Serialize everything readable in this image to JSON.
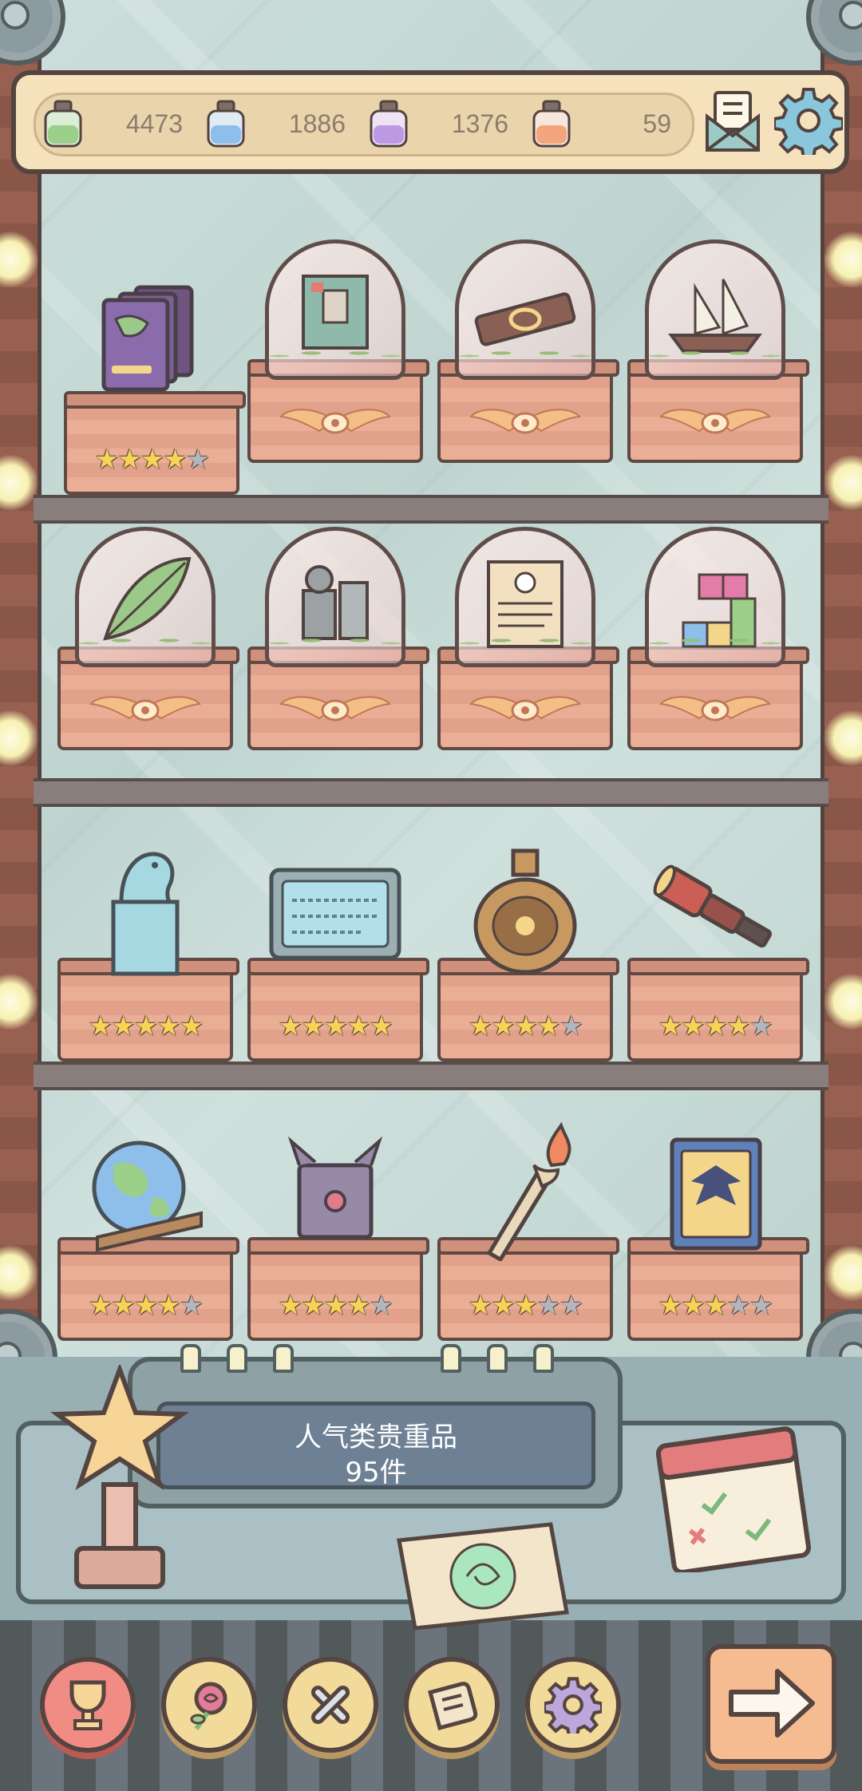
{
  "resources": [
    {
      "icon": "green-ink-bottle-icon",
      "value": "4473",
      "color": "#8fc97a"
    },
    {
      "icon": "blue-ink-bottle-icon",
      "value": "1886",
      "color": "#7fb7e8"
    },
    {
      "icon": "purple-ink-bottle-icon",
      "value": "1376",
      "color": "#b58be0"
    },
    {
      "icon": "orange-ink-bottle-icon",
      "value": "59",
      "color": "#f29a6a"
    }
  ],
  "shelves": [
    {
      "items": [
        {
          "name": "book-stack",
          "state": "owned",
          "stars": 4,
          "max_stars": 5
        },
        {
          "name": "locked-scroll-1",
          "state": "domed"
        },
        {
          "name": "locked-scroll-2",
          "state": "domed"
        },
        {
          "name": "locked-ship",
          "state": "domed"
        }
      ]
    },
    {
      "items": [
        {
          "name": "locked-feather",
          "state": "domed"
        },
        {
          "name": "locked-statue",
          "state": "domed"
        },
        {
          "name": "locked-document",
          "state": "domed"
        },
        {
          "name": "locked-blocks",
          "state": "domed"
        }
      ]
    },
    {
      "items": [
        {
          "name": "dragon-statue",
          "state": "owned",
          "stars": 5,
          "max_stars": 5
        },
        {
          "name": "stone-tablet",
          "state": "owned",
          "stars": 5,
          "max_stars": 5
        },
        {
          "name": "ornate-flask",
          "state": "owned",
          "stars": 4,
          "max_stars": 5
        },
        {
          "name": "spyglass",
          "state": "owned",
          "stars": 4,
          "max_stars": 5
        }
      ]
    },
    {
      "items": [
        {
          "name": "globe",
          "state": "owned",
          "stars": 4,
          "max_stars": 5
        },
        {
          "name": "spiked-box",
          "state": "owned",
          "stars": 4,
          "max_stars": 5
        },
        {
          "name": "torch",
          "state": "owned",
          "stars": 3,
          "max_stars": 5
        },
        {
          "name": "eagle-book",
          "state": "owned",
          "stars": 3,
          "max_stars": 5
        }
      ]
    }
  ],
  "sign": {
    "title": "人气类贵重品",
    "count": "95件"
  },
  "nav": [
    {
      "icon": "trophy-icon",
      "active": true
    },
    {
      "icon": "rose-icon",
      "active": false
    },
    {
      "icon": "crossed-bones-icon",
      "active": false
    },
    {
      "icon": "scroll-icon",
      "active": false
    },
    {
      "icon": "gear-icon",
      "active": false
    }
  ],
  "colors": {
    "accent": "#f07d74",
    "star": "#f6cf3f",
    "cloth": "#e8a388",
    "topbar": "#f4dfb4"
  }
}
